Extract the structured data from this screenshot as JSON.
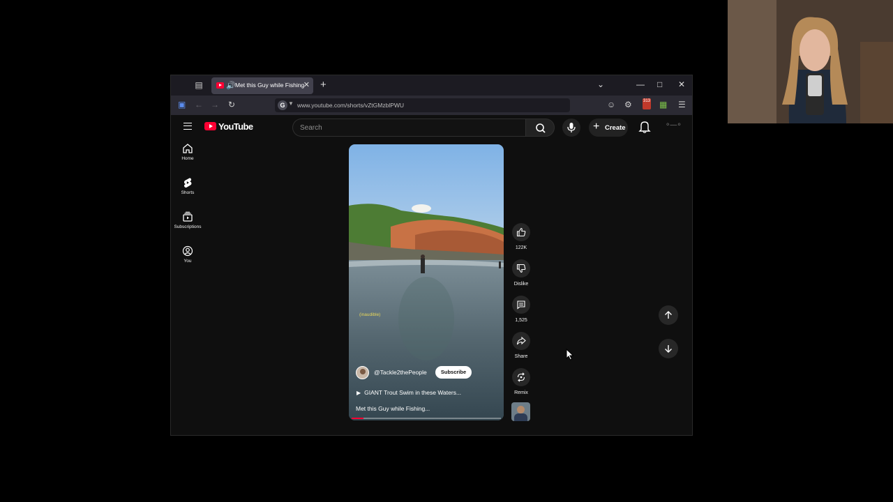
{
  "browser": {
    "tab_title": "Met this Guy while Fishing",
    "url": "www.youtube.com/shorts/vZtGMzblPWU",
    "extension_badge": "313"
  },
  "youtube": {
    "logo_text": "YouTube",
    "search_placeholder": "Search",
    "create_label": "Create"
  },
  "sidebar": {
    "items": [
      {
        "label": "Home",
        "icon": "home-icon"
      },
      {
        "label": "Shorts",
        "icon": "shorts-icon"
      },
      {
        "label": "Subscriptions",
        "icon": "subscriptions-icon"
      },
      {
        "label": "You",
        "icon": "you-icon"
      }
    ]
  },
  "short": {
    "caption": "(inaudible)",
    "channel": "@Tackle2thePeople",
    "subscribe_label": "Subscribe",
    "linked_video_title": "GIANT Trout Swim in these Waters...",
    "title": "Met this Guy while Fishing...",
    "progress": 0.08
  },
  "actions": {
    "likes": "122K",
    "dislike_label": "Dislike",
    "comments": "1,525",
    "share_label": "Share",
    "remix_label": "Remix"
  },
  "colors": {
    "brand_red": "#ff0033",
    "background": "#0f0f0f"
  }
}
